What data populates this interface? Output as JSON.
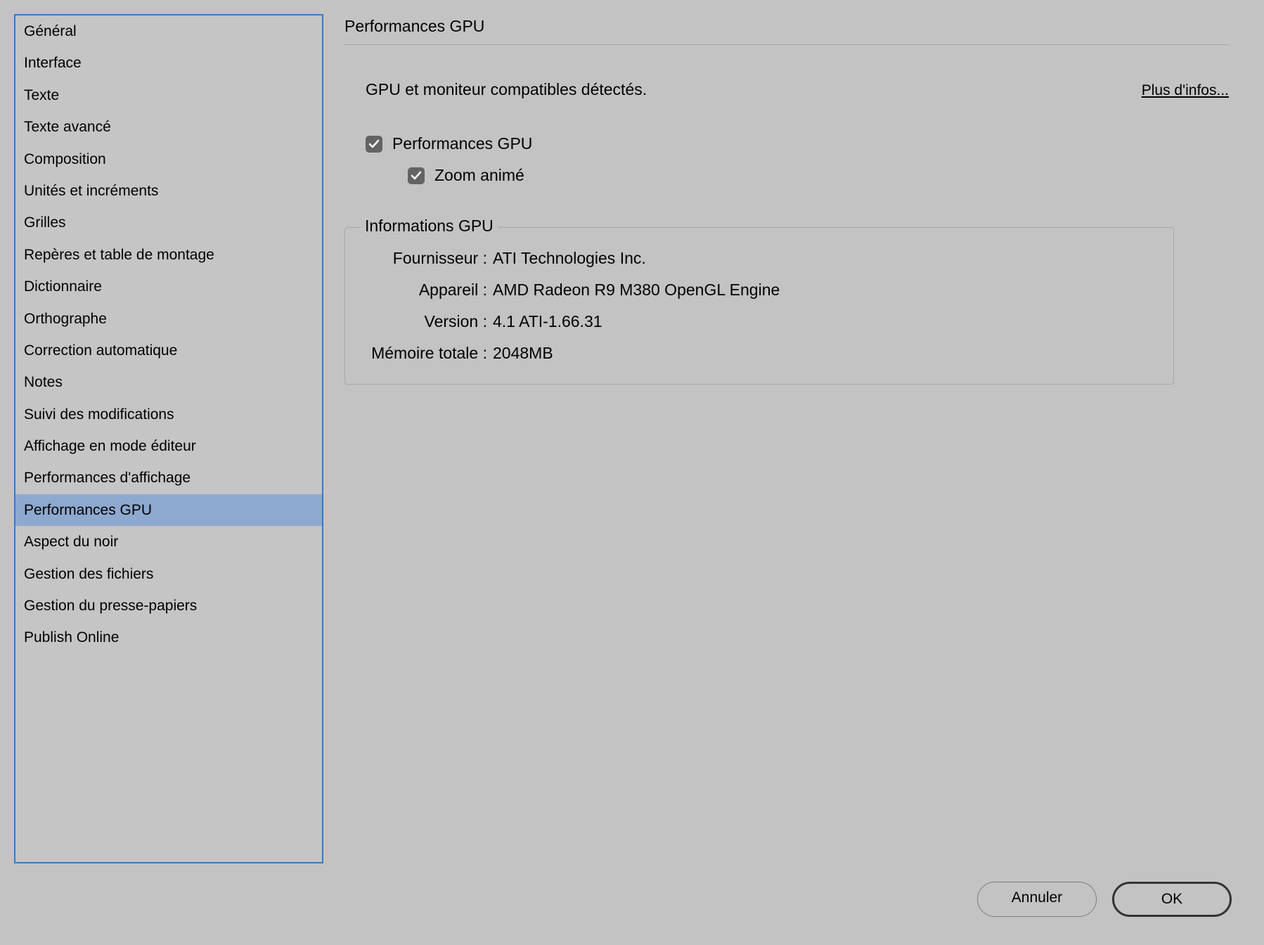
{
  "sidebar": {
    "items": [
      {
        "label": "Général"
      },
      {
        "label": "Interface"
      },
      {
        "label": "Texte"
      },
      {
        "label": "Texte avancé"
      },
      {
        "label": "Composition"
      },
      {
        "label": "Unités et incréments"
      },
      {
        "label": "Grilles"
      },
      {
        "label": "Repères et table de montage"
      },
      {
        "label": "Dictionnaire"
      },
      {
        "label": "Orthographe"
      },
      {
        "label": "Correction automatique"
      },
      {
        "label": "Notes"
      },
      {
        "label": "Suivi des modifications"
      },
      {
        "label": "Affichage en mode éditeur"
      },
      {
        "label": "Performances d'affichage"
      },
      {
        "label": "Performances GPU"
      },
      {
        "label": "Aspect du noir"
      },
      {
        "label": "Gestion des fichiers"
      },
      {
        "label": "Gestion du presse-papiers"
      },
      {
        "label": "Publish Online"
      }
    ],
    "selected_index": 15
  },
  "main": {
    "title": "Performances GPU",
    "status_text": "GPU et moniteur compatibles détectés.",
    "more_link": "Plus d'infos...",
    "checkbox_gpu": {
      "label": "Performances GPU",
      "checked": true
    },
    "checkbox_zoom": {
      "label": "Zoom animé",
      "checked": true
    },
    "gpu_fieldset": {
      "legend": "Informations GPU",
      "rows": [
        {
          "label": "Fournisseur :",
          "value": "ATI Technologies Inc."
        },
        {
          "label": "Appareil :",
          "value": "AMD Radeon R9 M380 OpenGL Engine"
        },
        {
          "label": "Version :",
          "value": "4.1 ATI-1.66.31"
        },
        {
          "label": "Mémoire totale :",
          "value": "2048MB"
        }
      ]
    }
  },
  "buttons": {
    "cancel": "Annuler",
    "ok": "OK"
  }
}
